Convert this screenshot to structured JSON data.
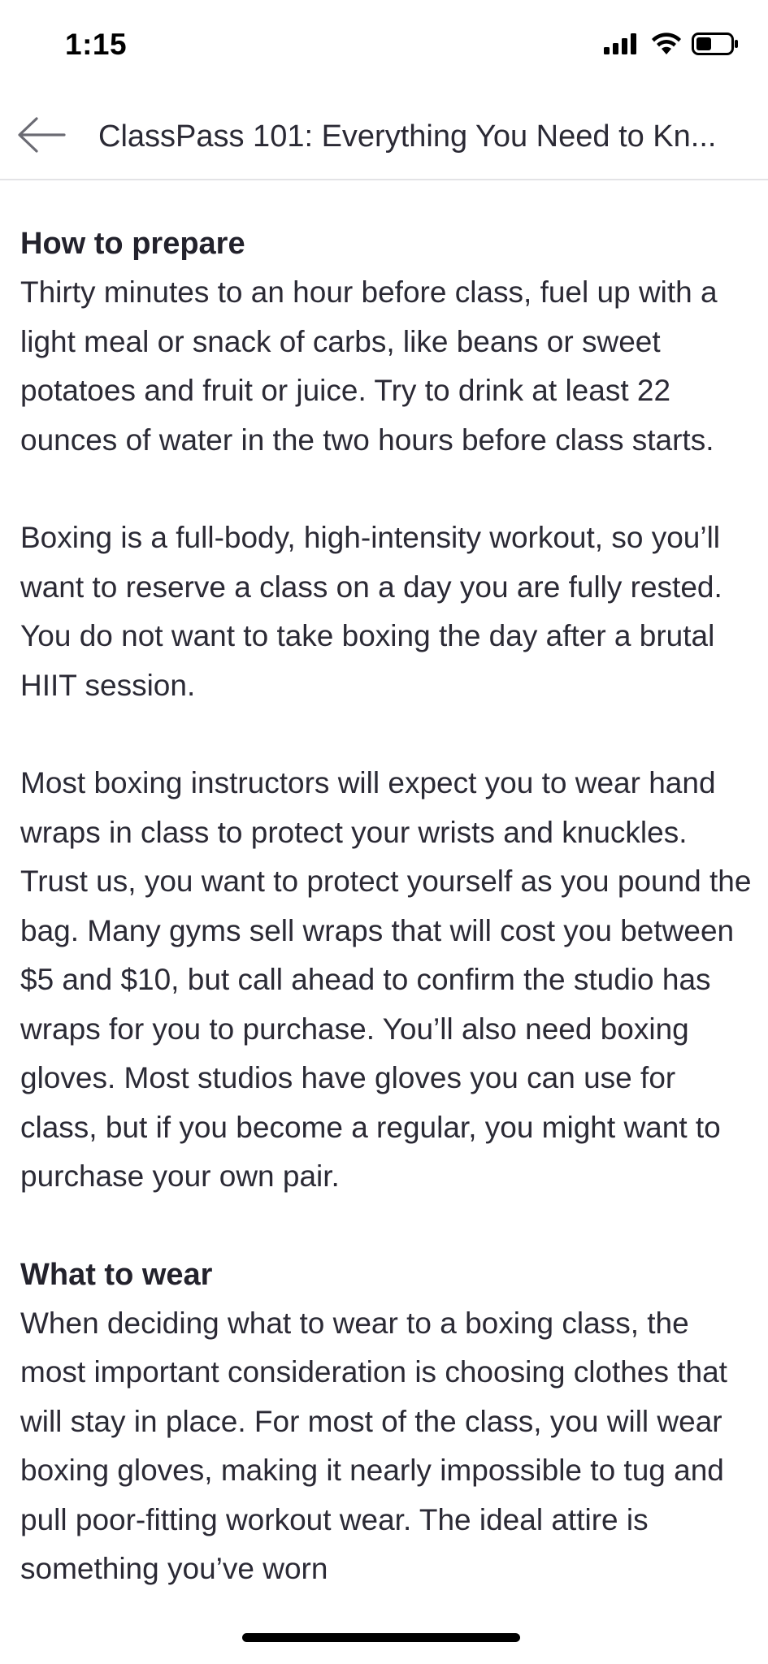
{
  "status_bar": {
    "time": "1:15",
    "icons": [
      "signal-icon",
      "wifi-icon",
      "battery-icon"
    ],
    "battery_level": 0.45
  },
  "nav": {
    "back_icon": "arrow-left-icon",
    "title": "ClassPass 101: Everything You Need to Kn..."
  },
  "article": {
    "section_prepare": {
      "heading": "How to prepare",
      "paragraphs": [
        "Thirty minutes to an hour before class, fuel up with a light meal or snack of carbs, like beans or sweet potatoes and fruit or juice. Try to drink at least 22 ounces of water in the two hours before class starts.",
        "Boxing is a full-body, high-intensity workout, so you’ll want to reserve a class on a day you are fully rested. You do not want to take boxing the day after a brutal HIIT session.",
        "Most boxing instructors will expect you to wear hand wraps in class to protect your wrists and knuckles. Trust us, you want to protect yourself as you pound the bag. Many gyms sell wraps that will cost you between $5 and $10, but call ahead to confirm the studio has wraps for you to purchase. You’ll also need boxing gloves. Most studios have gloves you can use for class, but if you become a regular, you might want to purchase your own pair."
      ]
    },
    "section_wear": {
      "heading": "What to wear",
      "paragraphs": [
        "When deciding what to wear to a boxing class, the most important consideration is choosing clothes that will stay in place. For most of the class, you will wear boxing gloves, making it nearly impossible to tug and pull poor-fitting workout wear. The ideal attire is something you’ve worn"
      ]
    }
  }
}
